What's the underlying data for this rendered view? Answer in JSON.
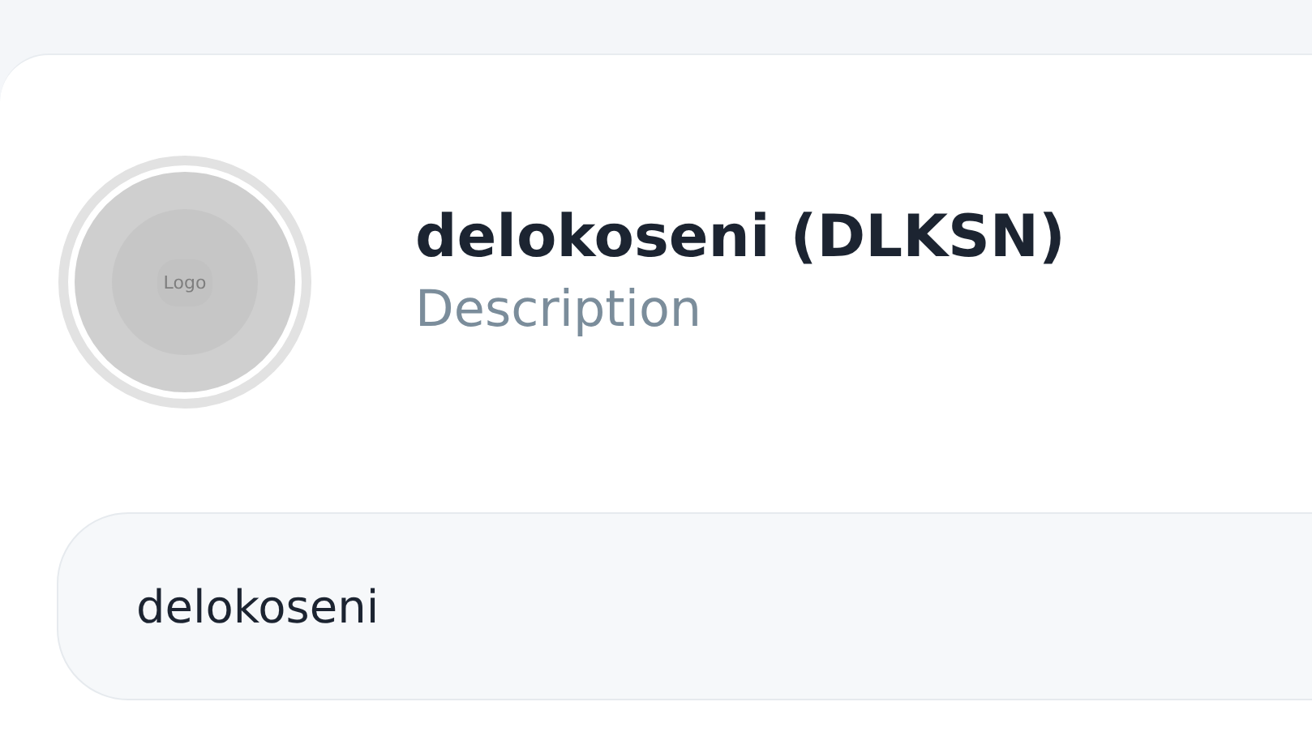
{
  "token": {
    "logo_text": "Logo",
    "name": "delokoseni (DLKSN)",
    "description": "Description"
  },
  "field": {
    "value": "delokoseni"
  }
}
